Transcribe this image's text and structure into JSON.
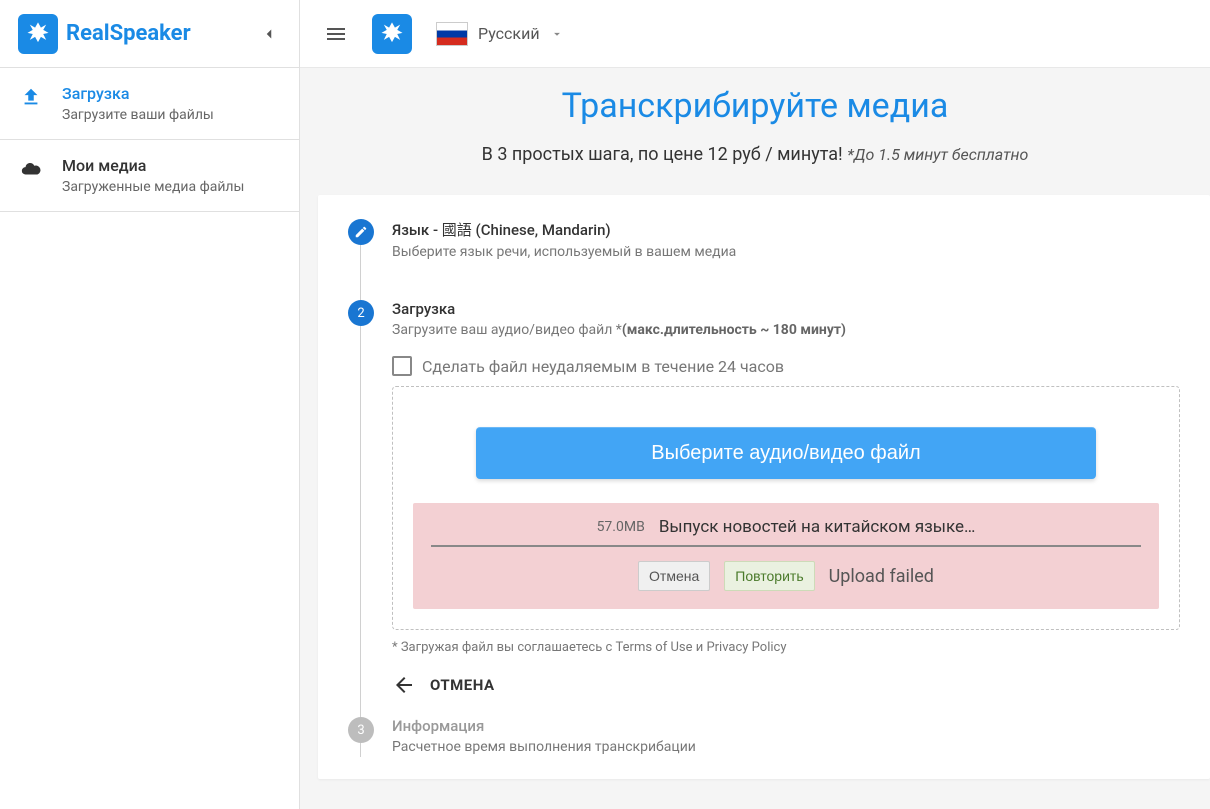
{
  "brand": "RealSpeaker",
  "sidebar": {
    "items": [
      {
        "title": "Загрузка",
        "sub": "Загрузите ваши файлы"
      },
      {
        "title": "Мои медиа",
        "sub": "Загруженные медиа файлы"
      }
    ]
  },
  "topbar": {
    "lang": "Русский"
  },
  "hero": {
    "title": "Транскрибируйте медиа",
    "sub_main": "В 3 простых шага, по цене 12 руб / минута! ",
    "sub_free": "*До 1.5 минут бесплатно"
  },
  "step1": {
    "title": "Язык - 國語 (Chinese, Mandarin)",
    "desc": "Выберите язык речи, используемый в вашем медиа"
  },
  "step2": {
    "badge": "2",
    "title": "Загрузка",
    "desc_prefix": "Загрузите ваш аудио/видео файл *",
    "desc_bold": "(макс.длительность ~ 180 минут)",
    "checkbox_label": "Сделать файл неудаляемым в течение 24 часов",
    "upload_btn": "Выберите аудио/видео файл",
    "file": {
      "size": "57.0MB",
      "name": "Выпуск новостей на китайском языке…",
      "cancel": "Отмена",
      "retry": "Повторить",
      "status": "Upload failed"
    },
    "terms_prefix": "* Загружая файл вы соглашаетесь с ",
    "terms_tos": "Terms of Use",
    "terms_and": " и ",
    "terms_pp": "Privacy Policy",
    "back": "ОТМЕНА"
  },
  "step3": {
    "badge": "3",
    "title": "Информация",
    "desc": "Расчетное время выполнения транскрибации"
  }
}
